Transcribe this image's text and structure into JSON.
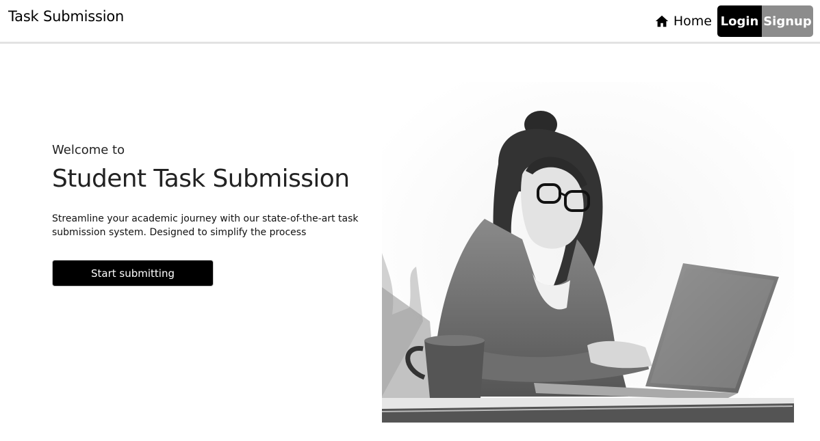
{
  "navbar": {
    "brand": "Task Submission",
    "home_icon": "home-icon",
    "home_label": "Home",
    "login_label": "Login",
    "signup_label": "Signup"
  },
  "hero": {
    "welcome": "Welcome to",
    "title": "Student Task Submission",
    "description": "Streamline your academic journey with our state-of-the-art task submission system. Designed to simplify the process",
    "cta_label": "Start submitting"
  },
  "colors": {
    "primary": "#000000",
    "signup_bg": "#8c8c8c",
    "navbar_border": "#e2e2e2"
  }
}
